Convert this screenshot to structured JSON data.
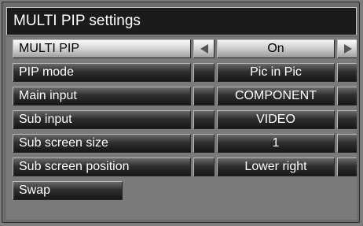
{
  "title": "MULTI PIP settings",
  "rows": [
    {
      "label": "MULTI PIP",
      "value": "On",
      "selected": true
    },
    {
      "label": "PIP mode",
      "value": "Pic in Pic"
    },
    {
      "label": "Main input",
      "value": "COMPONENT"
    },
    {
      "label": "Sub input",
      "value": "VIDEO"
    },
    {
      "label": "Sub screen size",
      "value": "1"
    },
    {
      "label": "Sub screen position",
      "value": "Lower right"
    }
  ],
  "swap_label": "Swap",
  "icons": {
    "left_arrow": "triangle-left",
    "right_arrow": "triangle-right"
  }
}
